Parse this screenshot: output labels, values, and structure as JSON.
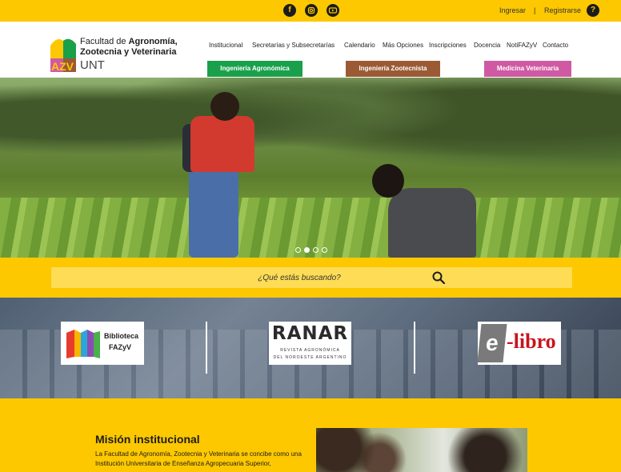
{
  "topbar": {
    "social": [
      "facebook-icon",
      "instagram-icon",
      "youtube-icon"
    ],
    "login": "Ingresar",
    "separator": "|",
    "register": "Registrarse",
    "help": "?"
  },
  "header": {
    "logo": {
      "mark": "AZV",
      "line1_prefix": "Facultad de ",
      "line1_bold": "Agronomía,",
      "line2": "Zootecnia y Veterinaria",
      "unt": "UNT"
    },
    "nav": [
      "Institucional",
      "Secretarías y Subsecretarías",
      "Calendario",
      "Más Opciones",
      "Inscripciones",
      "Docencia",
      "NotiFAZyV",
      "Contacto"
    ],
    "careers": [
      "Ingeniería Agronómica",
      "Ingeniería Zootecnista",
      "Medicina Veterinaria"
    ]
  },
  "hero": {
    "slides": 4,
    "active_slide": 2
  },
  "search": {
    "placeholder": "¿Qué estás buscando?"
  },
  "resources": {
    "biblioteca": {
      "line1": "Biblioteca",
      "line2": "FAZyV"
    },
    "ranar": {
      "title": "RANAR",
      "sub1": "REVISTA AGRONÓMICA",
      "sub2": "DEL NOROESTE ARGENTINO"
    },
    "elibro": {
      "mark": "e",
      "text": "-libro"
    }
  },
  "mission": {
    "title": "Misión institucional",
    "text": "La Facultad de Agronomía, Zootecnia y Veterinaria se concibe como una Institución Universitaria de Enseñanza Agropecuaria Superior,"
  },
  "colors": {
    "brand_yellow": "#fdc800",
    "agro": "#1aa04b",
    "zoo": "#9b5a34",
    "vet": "#cf5aa3"
  }
}
